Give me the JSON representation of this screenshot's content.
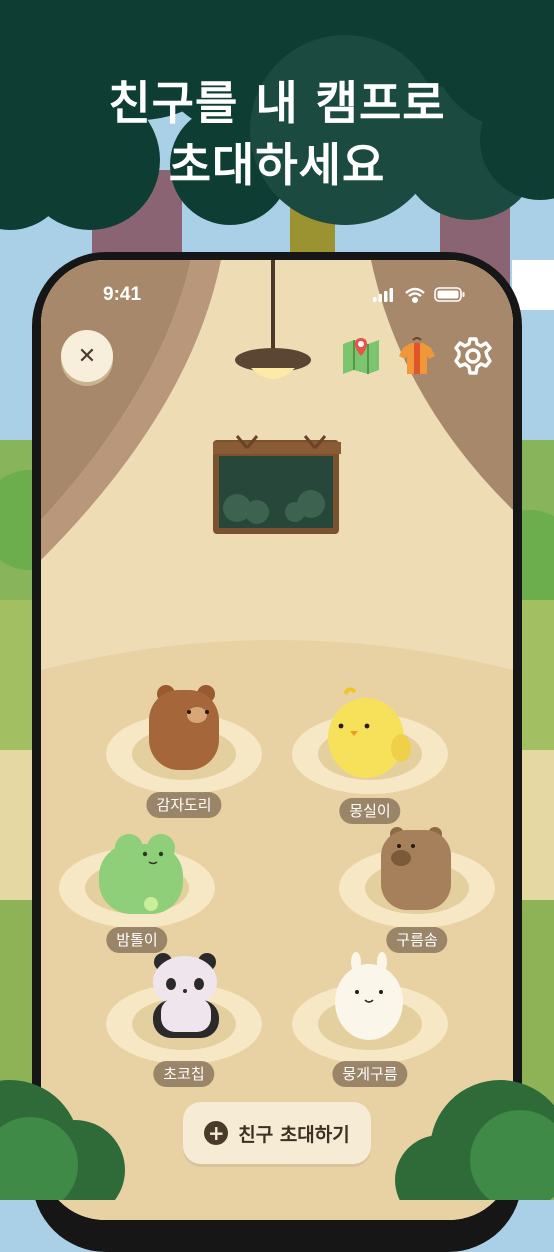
{
  "headline": {
    "line1": "친구를 내 캠프로",
    "line2": "초대하세요"
  },
  "status_bar": {
    "time": "9:41",
    "icons": [
      "signal-icon",
      "wifi-icon",
      "battery-icon"
    ]
  },
  "top_bar": {
    "close_glyph": "✕",
    "icons": [
      "map-icon",
      "outfit-icon",
      "settings-icon"
    ]
  },
  "friends": [
    {
      "name": "감자도리",
      "animal": "brown-bear"
    },
    {
      "name": "몽실이",
      "animal": "yellow-chick"
    },
    {
      "name": "밤톨이",
      "animal": "green-frog"
    },
    {
      "name": "구름솜",
      "animal": "capybara"
    },
    {
      "name": "초코칩",
      "animal": "panda"
    },
    {
      "name": "뭉게구름",
      "animal": "white-bunny"
    }
  ],
  "invite_button": {
    "plus_glyph": "+",
    "label": "친구 초대하기"
  },
  "colors": {
    "tree_dark": "#0e3d33",
    "tent_brown": "#a8886a",
    "tent_floor": "#eedcb5",
    "label_bg": "#8c785f"
  }
}
